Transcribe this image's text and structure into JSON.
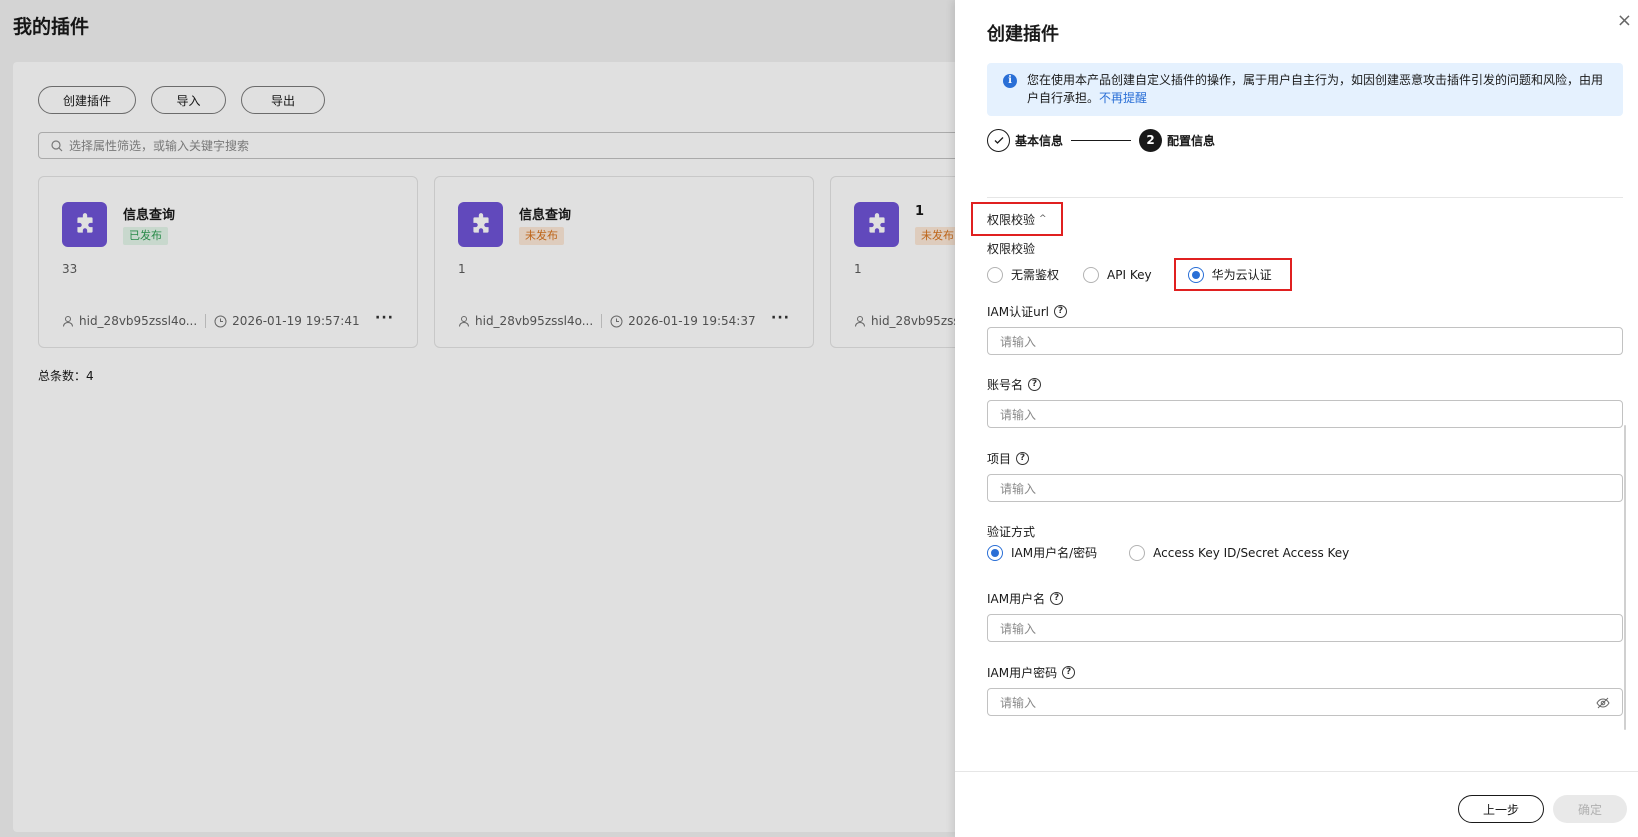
{
  "background": {
    "page_title": "我的插件",
    "buttons": {
      "create": "创建插件",
      "import": "导入",
      "export": "导出"
    },
    "search_placeholder": "选择属性筛选，或输入关键字搜索",
    "cards": [
      {
        "name": "信息查询",
        "status": "已发布",
        "status_color": "#2f9e54",
        "desc": "33",
        "owner": "hid_28vb95zssl4o...",
        "time": "2026-01-19 19:57:41",
        "more": "···"
      },
      {
        "name": "信息查询",
        "status": "未发布",
        "status_color": "#d8731d",
        "desc": "1",
        "owner": "hid_28vb95zssl4o...",
        "time": "2026-01-19 19:54:37",
        "more": "···"
      },
      {
        "name": "1",
        "status": "未发布",
        "status_color": "#d8731d",
        "desc": "1",
        "owner": "hid_28vb95zss"
      }
    ],
    "total": "总条数：4"
  },
  "drawer": {
    "title": "创建插件",
    "close": "×",
    "notice": {
      "text": "您在使用本产品创建自定义插件的操作，属于用户自主行为，如因创建恶意攻击插件引发的问题和风险，由用户自行承担。",
      "link": "不再提醒"
    },
    "steps": [
      {
        "label": "基本信息",
        "state": "done"
      },
      {
        "number": "2",
        "label": "配置信息",
        "state": "active"
      }
    ],
    "section_title": "权限校验",
    "auth": {
      "label": "权限校验",
      "options": [
        "无需鉴权",
        "API Key",
        "华为云认证"
      ],
      "selected": "华为云认证"
    },
    "fields": {
      "iam_url": {
        "label": "IAM认证url",
        "placeholder": "请输入"
      },
      "account": {
        "label": "账号名",
        "placeholder": "请输入"
      },
      "project": {
        "label": "项目",
        "placeholder": "请输入"
      },
      "iam_user": {
        "label": "IAM用户名",
        "placeholder": "请输入"
      },
      "iam_password": {
        "label": "IAM用户密码",
        "placeholder": "请输入"
      }
    },
    "verify": {
      "label": "验证方式",
      "options": [
        "IAM用户名/密码",
        "Access Key ID/Secret Access Key"
      ],
      "selected": "IAM用户名/密码"
    },
    "footer": {
      "prev": "上一步",
      "confirm": "确定"
    }
  },
  "colors": {
    "accent": "#2a6fd6",
    "highlight": "#e02020",
    "plugin_icon_bg": "#6f54d6"
  }
}
